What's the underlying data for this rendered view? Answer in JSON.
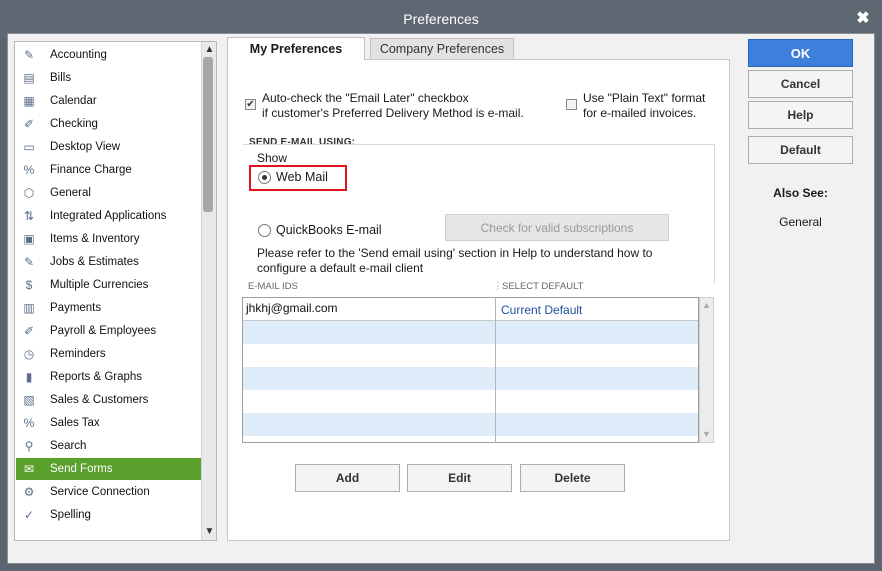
{
  "window": {
    "title": "Preferences"
  },
  "categories": [
    {
      "label": "Accounting",
      "icon": "accounting-icon",
      "glyph": "✎"
    },
    {
      "label": "Bills",
      "icon": "bills-icon",
      "glyph": "▤"
    },
    {
      "label": "Calendar",
      "icon": "calendar-icon",
      "glyph": "▦"
    },
    {
      "label": "Checking",
      "icon": "checking-icon",
      "glyph": "✐"
    },
    {
      "label": "Desktop View",
      "icon": "desktop-view-icon",
      "glyph": "▭"
    },
    {
      "label": "Finance Charge",
      "icon": "finance-charge-icon",
      "glyph": "%"
    },
    {
      "label": "General",
      "icon": "general-icon",
      "glyph": "⬡"
    },
    {
      "label": "Integrated Applications",
      "icon": "integrated-applications-icon",
      "glyph": "⇅"
    },
    {
      "label": "Items & Inventory",
      "icon": "items-inventory-icon",
      "glyph": "▣"
    },
    {
      "label": "Jobs & Estimates",
      "icon": "jobs-estimates-icon",
      "glyph": "✎"
    },
    {
      "label": "Multiple Currencies",
      "icon": "multiple-currencies-icon",
      "glyph": "$"
    },
    {
      "label": "Payments",
      "icon": "payments-icon",
      "glyph": "▥"
    },
    {
      "label": "Payroll & Employees",
      "icon": "payroll-employees-icon",
      "glyph": "✐"
    },
    {
      "label": "Reminders",
      "icon": "reminders-icon",
      "glyph": "◷"
    },
    {
      "label": "Reports & Graphs",
      "icon": "reports-graphs-icon",
      "glyph": "▮"
    },
    {
      "label": "Sales & Customers",
      "icon": "sales-customers-icon",
      "glyph": "▧"
    },
    {
      "label": "Sales Tax",
      "icon": "sales-tax-icon",
      "glyph": "%"
    },
    {
      "label": "Search",
      "icon": "search-icon",
      "glyph": "⚲"
    },
    {
      "label": "Send Forms",
      "icon": "send-forms-icon",
      "glyph": "✉",
      "selected": true
    },
    {
      "label": "Service Connection",
      "icon": "service-connection-icon",
      "glyph": "⚙"
    },
    {
      "label": "Spelling",
      "icon": "spelling-icon",
      "glyph": "✓"
    }
  ],
  "tabs": {
    "my_prefs": "My Preferences",
    "company_prefs": "Company Preferences"
  },
  "options": {
    "email_later_line1": "Auto-check the \"Email Later\" checkbox",
    "email_later_line2": "if customer's Preferred Delivery Method is e-mail.",
    "email_later_checked": true,
    "plain_text_line1": "Use \"Plain Text\" format",
    "plain_text_line2": "for e-mailed invoices.",
    "plain_text_checked": false
  },
  "send_email": {
    "heading": "SEND E-MAIL USING:",
    "show_label": "Show",
    "web_mail_label": "Web Mail",
    "web_mail_selected": true,
    "qb_email_label": "QuickBooks E-mail",
    "qb_email_selected": false,
    "check_button": "Check for valid subscriptions",
    "help_line1": "Please refer to the 'Send email using' section in Help to understand how to",
    "help_line2": "configure a default e-mail client"
  },
  "email_grid": {
    "col_ids": "E-MAIL IDS",
    "col_default": "SELECT DEFAULT",
    "rows": [
      {
        "email": "jhkhj@gmail.com",
        "default": "Current Default"
      },
      {
        "email": "",
        "default": ""
      },
      {
        "email": "",
        "default": ""
      },
      {
        "email": "",
        "default": ""
      },
      {
        "email": "",
        "default": ""
      },
      {
        "email": "",
        "default": ""
      }
    ]
  },
  "grid_buttons": {
    "add": "Add",
    "edit": "Edit",
    "delete": "Delete"
  },
  "side_buttons": {
    "ok": "OK",
    "cancel": "Cancel",
    "help": "Help",
    "default": "Default"
  },
  "also_see": {
    "heading": "Also See:",
    "link": "General"
  },
  "colors": {
    "selected_category": "#5aa02c",
    "ok_button": "#3d7fdb",
    "highlight_box": "#e0141e",
    "grid_alt_row": "#deebf9",
    "link_text": "#1f4f9e"
  }
}
